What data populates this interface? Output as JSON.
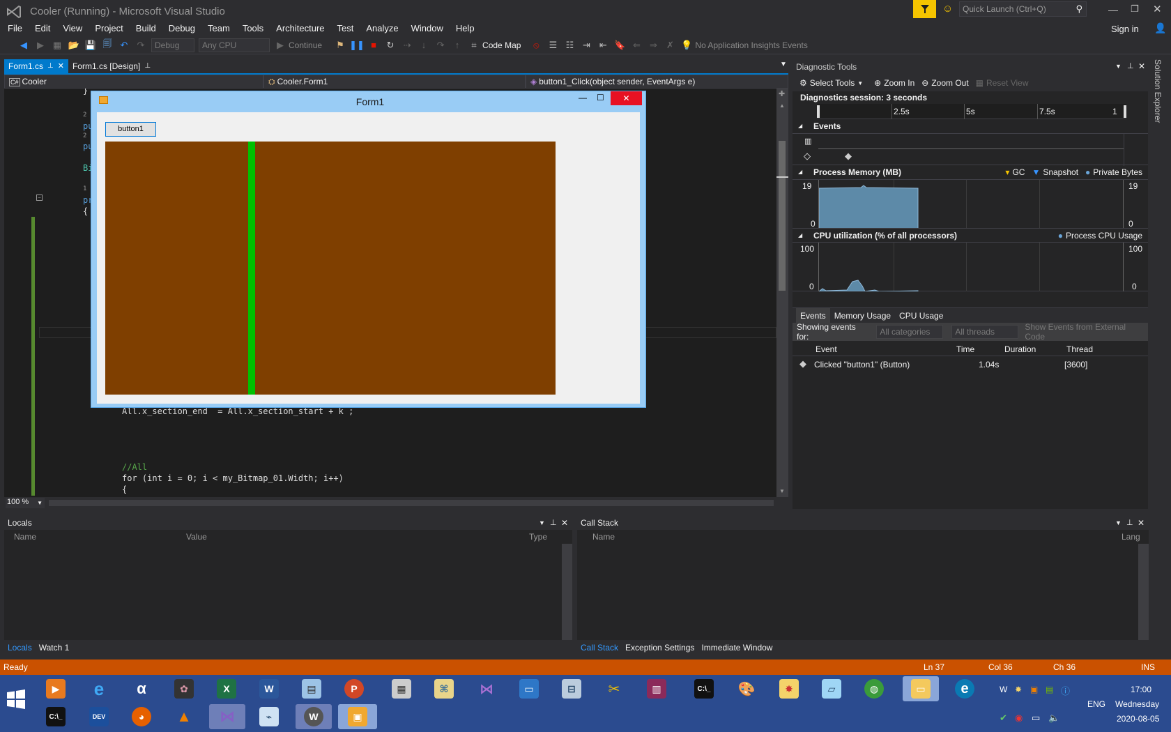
{
  "window": {
    "title": "Cooler (Running) - Microsoft Visual Studio",
    "quick_launch_placeholder": "Quick Launch (Ctrl+Q)",
    "sign_in": "Sign in"
  },
  "menu": [
    "File",
    "Edit",
    "View",
    "Project",
    "Build",
    "Debug",
    "Team",
    "Tools",
    "Architecture",
    "Test",
    "Analyze",
    "Window",
    "Help"
  ],
  "toolbar": {
    "config": "Debug",
    "platform": "Any CPU",
    "continue_label": "Continue",
    "code_map_label": "Code Map",
    "insights_label": "No Application Insights Events"
  },
  "doc_tabs": [
    {
      "label": "Form1.cs",
      "active": true
    },
    {
      "label": "Form1.cs [Design]",
      "active": false
    }
  ],
  "nav": {
    "project": "Cooler",
    "class": "Cooler.Form1",
    "member": "button1_Click(object sender, EventArgs e)"
  },
  "code": {
    "line1": "All.x_section_end  = All.x_section_start + k ;",
    "line2": "//All",
    "line3": "for (int i = 0; i < my_Bitmap_01.Width; i++)",
    "line4": "{",
    "brace_top": "}",
    "brace_open": "{",
    "snippets": [
      "2 r",
      "pu",
      "2 r",
      "pu",
      "Bi",
      "1 r",
      "pr"
    ]
  },
  "zoom_level": "100 %",
  "form1": {
    "title": "Form1",
    "button_label": "button1",
    "picture_color": "#7f3f00",
    "bar_color": "#00c000"
  },
  "diagnostic": {
    "title": "Diagnostic Tools",
    "select_tools": "Select Tools",
    "zoom_in": "Zoom In",
    "zoom_out": "Zoom Out",
    "reset_view": "Reset View",
    "session": "Diagnostics session: 3 seconds",
    "ruler_ticks": [
      "2.5s",
      "5s",
      "7.5s",
      "1"
    ],
    "events_label": "Events",
    "memory_label": "Process Memory (MB)",
    "memory_legend": [
      "GC",
      "Snapshot",
      "Private Bytes"
    ],
    "memory_max": "19",
    "memory_min": "0",
    "cpu_label": "CPU utilization (% of all processors)",
    "cpu_legend": "Process CPU Usage",
    "cpu_max": "100",
    "cpu_min": "0",
    "tabs": [
      "Events",
      "Memory Usage",
      "CPU Usage"
    ],
    "showing_events_for": "Showing events for:",
    "filter_categories": "All categories",
    "filter_threads": "All threads",
    "external_code": "Show Events from External Code",
    "table_headers": [
      "Event",
      "Time",
      "Duration",
      "Thread"
    ],
    "rows": [
      {
        "event": "Clicked \"button1\" (Button)",
        "time": "1.04s",
        "duration": "",
        "thread": "[3600]"
      }
    ]
  },
  "side_tab": "Solution Explorer",
  "locals": {
    "title": "Locals",
    "headers": [
      "Name",
      "Value",
      "Type"
    ],
    "tabs": [
      "Locals",
      "Watch 1"
    ]
  },
  "callstack": {
    "title": "Call Stack",
    "headers": [
      "Name",
      "Lang"
    ],
    "tabs": [
      "Call Stack",
      "Exception Settings",
      "Immediate Window"
    ]
  },
  "status": {
    "text": "Ready",
    "ln": "Ln 37",
    "col": "Col 36",
    "ch": "Ch 36",
    "mode": "INS"
  },
  "tray": {
    "lang": "ENG",
    "time": "17:00",
    "day": "Wednesday",
    "date": "2020-08-05"
  },
  "colors": {
    "accent": "#007acc",
    "status_bar": "#ca5100",
    "taskbar": "#2b4b8f"
  }
}
